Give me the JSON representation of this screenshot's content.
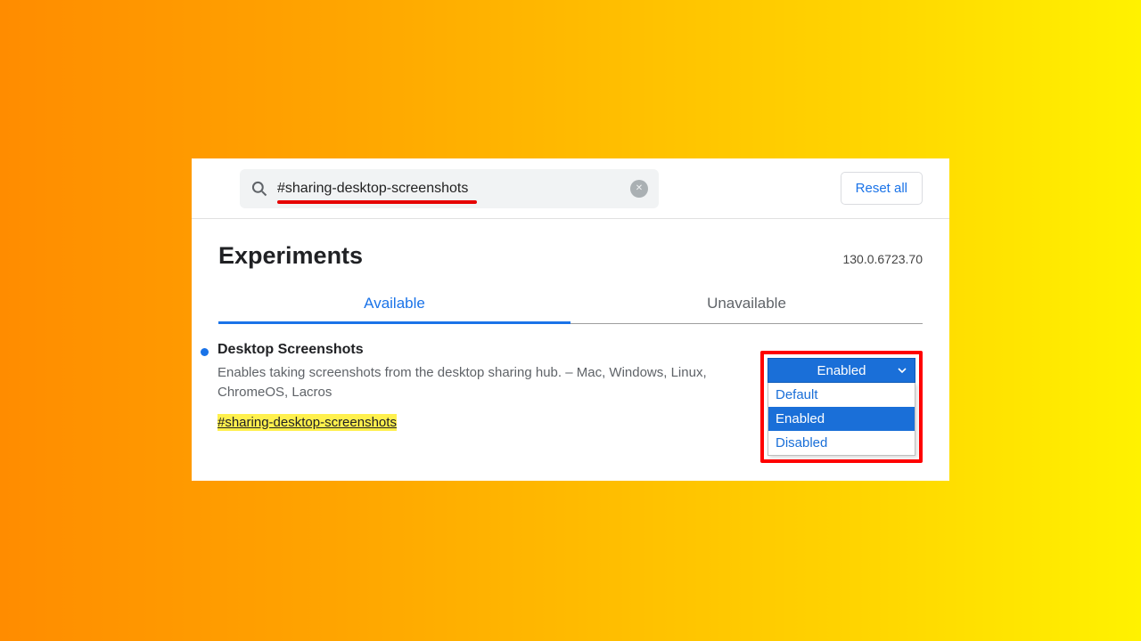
{
  "search": {
    "value": "#sharing-desktop-screenshots"
  },
  "buttons": {
    "reset": "Reset all"
  },
  "header": {
    "title": "Experiments",
    "version": "130.0.6723.70"
  },
  "tabs": {
    "available": "Available",
    "unavailable": "Unavailable"
  },
  "flag": {
    "title": "Desktop Screenshots",
    "description": "Enables taking screenshots from the desktop sharing hub. – Mac, Windows, Linux, ChromeOS, Lacros",
    "hash": "#sharing-desktop-screenshots"
  },
  "dropdown": {
    "selected": "Enabled",
    "options": [
      "Default",
      "Enabled",
      "Disabled"
    ]
  }
}
